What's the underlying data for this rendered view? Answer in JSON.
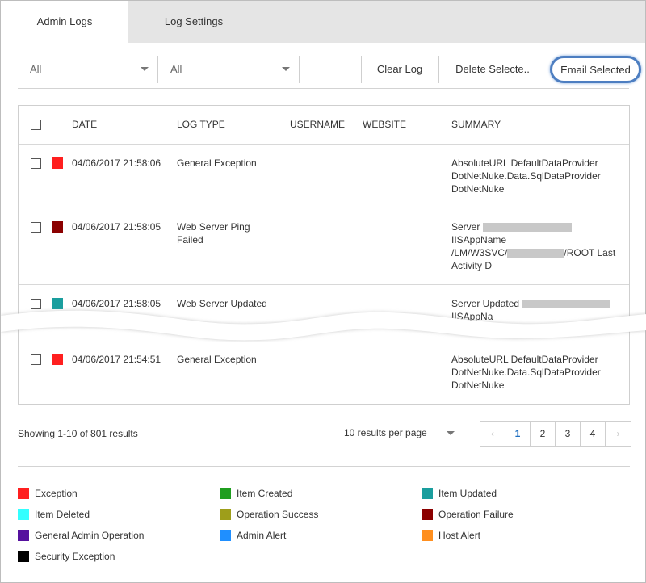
{
  "tabs": [
    {
      "label": "Admin Logs",
      "active": true
    },
    {
      "label": "Log Settings",
      "active": false
    }
  ],
  "toolbar": {
    "filter1_value": "All",
    "filter2_value": "All",
    "clear_label": "Clear Log",
    "delete_label": "Delete Selecte..",
    "email_label": "Email Selected"
  },
  "table": {
    "headers": {
      "date": "DATE",
      "log_type": "LOG TYPE",
      "username": "USERNAME",
      "website": "WEBSITE",
      "summary": "SUMMARY"
    },
    "rows": [
      {
        "date": "04/06/2017 21:58:06",
        "type": "General Exception",
        "color": "#ff1f1f",
        "summary": [
          "AbsoluteURL DefaultDataProvider",
          "DotNetNuke.Data.SqlDataProvider",
          "DotNetNuke"
        ]
      },
      {
        "date": "04/06/2017 21:58:05",
        "type_lines": [
          "Web Server Ping",
          "Failed"
        ],
        "color": "#8b0000",
        "summary_server": "Server",
        "summary_line2": "IISAppName",
        "summary_line3_a": "/LM/W3SVC/",
        "summary_line3_b": "/ROOT Last",
        "summary_line4": "Activity D"
      },
      {
        "date": "04/06/2017 21:58:05",
        "type": "Web Server Updated",
        "color": "#1a9e9e",
        "summary_line1": "Server Updated",
        "summary_line2": "IISAppNa"
      },
      {
        "date": "04/06/2017 21:54:51",
        "type": "General Exception",
        "color": "#ff1f1f",
        "summary": [
          "AbsoluteURL DefaultDataProvider",
          "DotNetNuke.Data.SqlDataProvider",
          "DotNetNuke"
        ]
      }
    ]
  },
  "pagination": {
    "showing": "Showing 1-10 of 801 results",
    "per_page": "10 results per page",
    "prev": "‹",
    "next": "›",
    "pages": [
      "1",
      "2",
      "3",
      "4"
    ],
    "current": "1"
  },
  "legend": [
    {
      "label": "Exception",
      "color": "#ff1f1f"
    },
    {
      "label": "Item Created",
      "color": "#1f9e1f"
    },
    {
      "label": "Item Updated",
      "color": "#1a9e9e"
    },
    {
      "label": "Item Deleted",
      "color": "#33ffff"
    },
    {
      "label": "Operation Success",
      "color": "#9e9e1a"
    },
    {
      "label": "Operation Failure",
      "color": "#8b0000"
    },
    {
      "label": "General Admin Operation",
      "color": "#55119e"
    },
    {
      "label": "Admin Alert",
      "color": "#1f8fff"
    },
    {
      "label": "Host Alert",
      "color": "#ff8f1f"
    },
    {
      "label": "Security Exception",
      "color": "#000000"
    }
  ]
}
